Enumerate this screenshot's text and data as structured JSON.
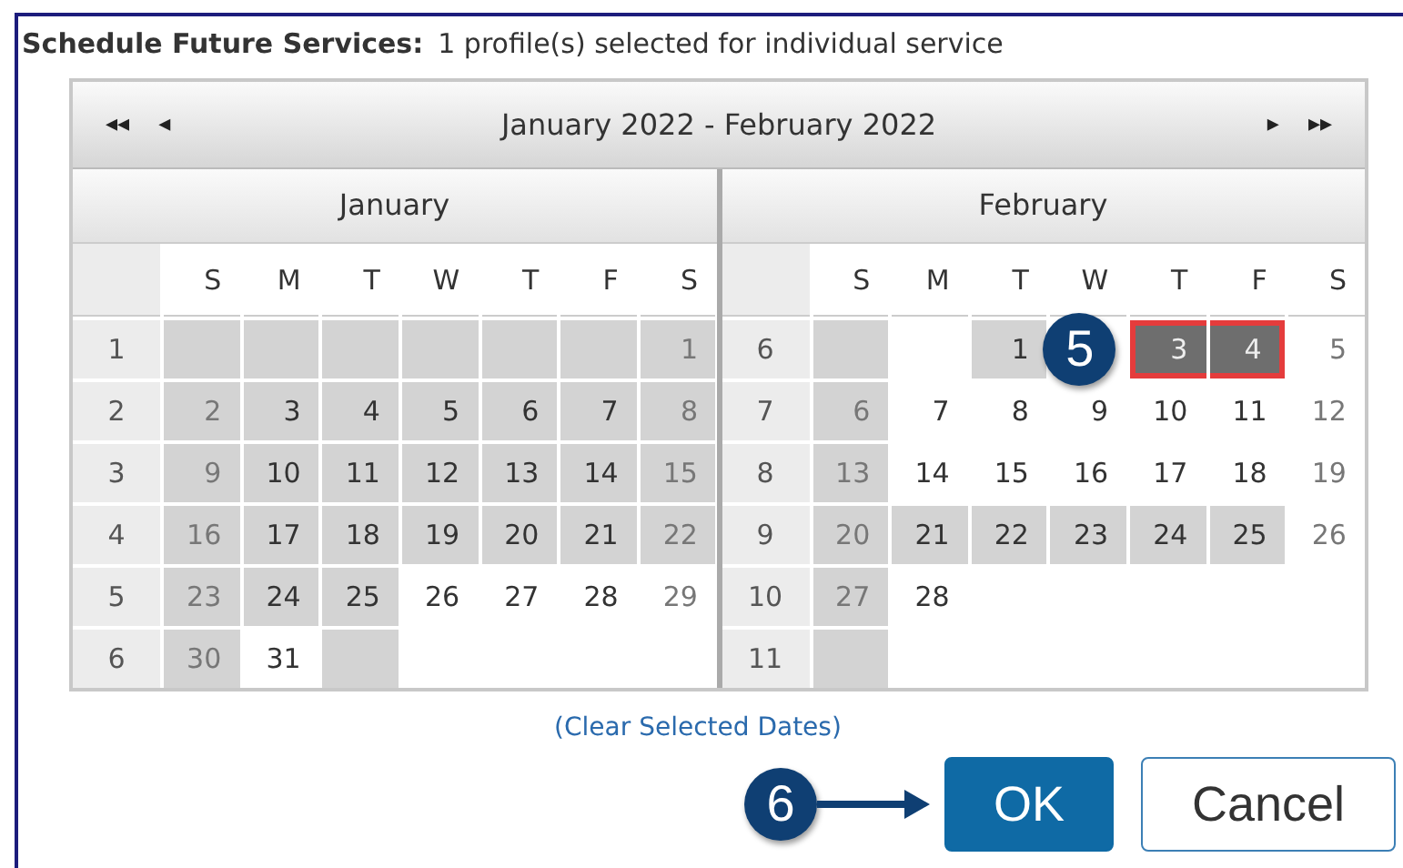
{
  "heading": {
    "title": "Schedule Future Services:",
    "subtitle": "1 profile(s) selected for individual service"
  },
  "calendar": {
    "range": "January 2022 - February 2022",
    "nav": [
      "◂◂",
      "◂",
      "▸",
      "▸▸"
    ],
    "months": [
      {
        "name": "January",
        "weekdays": [
          "S",
          "M",
          "T",
          "W",
          "T",
          "F",
          "S"
        ],
        "weeks": [
          {
            "week": "1",
            "days": [
              {
                "blocked": true,
                "selected": false
              },
              {
                "blocked": true,
                "selected": false
              },
              {
                "blocked": true,
                "selected": false
              },
              {
                "blocked": true,
                "selected": false
              },
              {
                "blocked": true,
                "selected": false
              },
              {
                "blocked": true,
                "selected": false
              },
              {
                "day": "1",
                "blocked": true,
                "selected": false
              }
            ]
          },
          {
            "week": "2",
            "days": [
              {
                "day": "2",
                "blocked": true,
                "selected": false
              },
              {
                "day": "3",
                "blocked": true,
                "selected": false
              },
              {
                "day": "4",
                "blocked": true,
                "selected": false
              },
              {
                "day": "5",
                "blocked": true,
                "selected": false
              },
              {
                "day": "6",
                "blocked": true,
                "selected": false
              },
              {
                "day": "7",
                "blocked": true,
                "selected": false
              },
              {
                "day": "8",
                "blocked": true,
                "selected": false
              }
            ]
          },
          {
            "week": "3",
            "days": [
              {
                "day": "9",
                "blocked": true,
                "selected": false
              },
              {
                "day": "10",
                "blocked": true,
                "selected": false
              },
              {
                "day": "11",
                "blocked": true,
                "selected": false
              },
              {
                "day": "12",
                "blocked": true,
                "selected": false
              },
              {
                "day": "13",
                "blocked": true,
                "selected": false
              },
              {
                "day": "14",
                "blocked": true,
                "selected": false
              },
              {
                "day": "15",
                "blocked": true,
                "selected": false
              }
            ]
          },
          {
            "week": "4",
            "days": [
              {
                "day": "16",
                "blocked": true,
                "selected": false
              },
              {
                "day": "17",
                "blocked": true,
                "selected": false
              },
              {
                "day": "18",
                "blocked": true,
                "selected": false
              },
              {
                "day": "19",
                "blocked": true,
                "selected": false
              },
              {
                "day": "20",
                "blocked": true,
                "selected": false
              },
              {
                "day": "21",
                "blocked": true,
                "selected": false
              },
              {
                "day": "22",
                "blocked": true,
                "selected": false
              }
            ]
          },
          {
            "week": "5",
            "days": [
              {
                "day": "23",
                "blocked": true,
                "selected": false
              },
              {
                "day": "24",
                "blocked": true,
                "selected": false
              },
              {
                "day": "25",
                "blocked": true,
                "selected": false
              },
              {
                "day": "26",
                "blocked": false,
                "selected": false
              },
              {
                "day": "27",
                "blocked": false,
                "selected": false
              },
              {
                "day": "28",
                "blocked": false,
                "selected": false
              },
              {
                "day": "29",
                "blocked": false,
                "selected": false
              }
            ]
          },
          {
            "week": "6",
            "days": [
              {
                "day": "30",
                "blocked": true,
                "selected": false
              },
              {
                "day": "31",
                "blocked": false,
                "selected": false
              },
              {
                "blocked": true,
                "selected": false
              },
              {
                "blocked": false,
                "selected": false
              },
              {
                "blocked": false,
                "selected": false
              },
              {
                "blocked": false,
                "selected": false
              },
              {
                "blocked": false,
                "selected": false
              }
            ]
          }
        ]
      },
      {
        "name": "February",
        "weekdays": [
          "S",
          "M",
          "T",
          "W",
          "T",
          "F",
          "S"
        ],
        "weeks": [
          {
            "week": "6",
            "days": [
              {
                "blocked": true,
                "selected": false
              },
              {
                "blocked": false,
                "selected": false
              },
              {
                "day": "1",
                "blocked": true,
                "selected": false
              },
              {
                "blocked": false,
                "selected": false
              },
              {
                "day": "3",
                "selected": true
              },
              {
                "day": "4",
                "selected": true
              },
              {
                "day": "5",
                "blocked": false,
                "selected": false
              }
            ]
          },
          {
            "week": "7",
            "days": [
              {
                "day": "6",
                "blocked": true,
                "selected": false
              },
              {
                "day": "7",
                "blocked": false,
                "selected": false
              },
              {
                "day": "8",
                "blocked": false,
                "selected": false
              },
              {
                "day": "9",
                "blocked": false,
                "selected": false
              },
              {
                "day": "10",
                "blocked": false,
                "selected": false
              },
              {
                "day": "11",
                "blocked": false,
                "selected": false
              },
              {
                "day": "12",
                "blocked": false,
                "selected": false
              }
            ]
          },
          {
            "week": "8",
            "days": [
              {
                "day": "13",
                "blocked": true,
                "selected": false
              },
              {
                "day": "14",
                "blocked": false,
                "selected": false
              },
              {
                "day": "15",
                "blocked": false,
                "selected": false
              },
              {
                "day": "16",
                "blocked": false,
                "selected": false
              },
              {
                "day": "17",
                "blocked": false,
                "selected": false
              },
              {
                "day": "18",
                "blocked": false,
                "selected": false
              },
              {
                "day": "19",
                "blocked": false,
                "selected": false
              }
            ]
          },
          {
            "week": "9",
            "days": [
              {
                "day": "20",
                "blocked": true,
                "selected": false
              },
              {
                "day": "21",
                "blocked": true,
                "selected": false
              },
              {
                "day": "22",
                "blocked": true,
                "selected": false
              },
              {
                "day": "23",
                "blocked": true,
                "selected": false
              },
              {
                "day": "24",
                "blocked": true,
                "selected": false
              },
              {
                "day": "25",
                "blocked": true,
                "selected": false
              },
              {
                "day": "26",
                "blocked": false,
                "selected": false
              }
            ]
          },
          {
            "week": "10",
            "days": [
              {
                "day": "27",
                "blocked": true,
                "selected": false
              },
              {
                "day": "28",
                "blocked": false,
                "selected": false
              },
              {
                "blocked": false,
                "selected": false
              },
              {
                "blocked": false,
                "selected": false
              },
              {
                "blocked": false,
                "selected": false
              },
              {
                "blocked": false,
                "selected": false
              },
              {
                "blocked": false,
                "selected": false
              }
            ]
          },
          {
            "week": "11",
            "days": [
              {
                "blocked": true,
                "selected": false
              },
              {
                "blocked": false,
                "selected": false
              },
              {
                "blocked": false,
                "selected": false
              },
              {
                "blocked": false,
                "selected": false
              },
              {
                "blocked": false,
                "selected": false
              },
              {
                "blocked": false,
                "selected": false
              },
              {
                "blocked": false,
                "selected": false
              }
            ]
          }
        ]
      }
    ]
  },
  "clear_link": "(Clear Selected Dates)",
  "callouts": [
    {
      "label": "5"
    },
    {
      "label": "6"
    }
  ],
  "buttons": [
    {
      "label": "OK",
      "kind": "primary"
    },
    {
      "label": "Cancel",
      "kind": "secondary"
    }
  ]
}
